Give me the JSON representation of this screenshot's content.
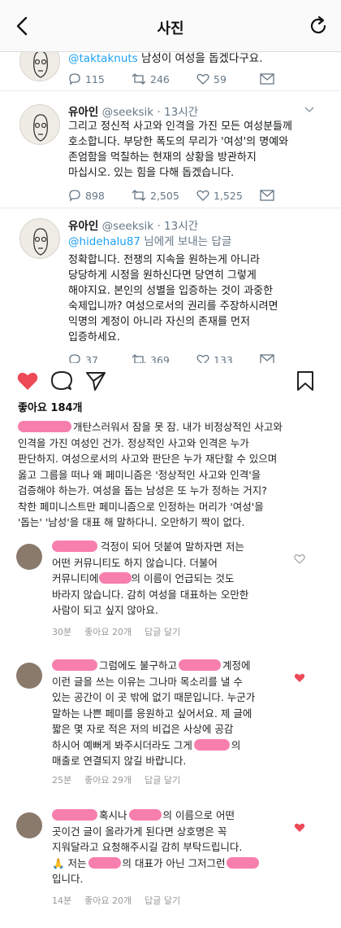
{
  "header": {
    "title": "사진"
  },
  "tweets": {
    "partial": {
      "mention": "@taktaknuts",
      "text": " 남성이 여성을 돕겠다구요.",
      "stats": {
        "replies": "115",
        "retweets": "246",
        "likes": "59"
      }
    },
    "tweet1": {
      "name": "유아인",
      "handle": "@seeksik",
      "time": "· 13시간",
      "lines": [
        "그리고 정신적 사고와 인격을 가진 모든 여성분들께",
        "호소합니다. 부당한 폭도의 무리가 '여성'의 명예와",
        "존엄함을 먹칠하는 현재의 상황을 방관하지",
        "마십시오. 있는 힘을 다해 돕겠습니다."
      ],
      "stats": {
        "replies": "898",
        "retweets": "2,505",
        "likes": "1,525"
      }
    },
    "tweet2": {
      "name": "유아인",
      "handle": "@seeksik",
      "time": "· 13시간",
      "reply_mention": "@hidehalu87",
      "reply_suffix": " 님에게 보내는 답글",
      "lines": [
        "정확합니다. 전쟁의 지속을 원하는게 아니라",
        "당당하게 시정을 원하신다면 당연히 그렇게",
        "해야지요. 본인의 성별을 입증하는 것이 과중한",
        "숙제입니까? 여성으로서의 권리를 주장하시려면",
        "익명의 계정이 아니라 자신의 존재를 먼저",
        "입증하세요."
      ],
      "stats": {
        "replies": "37",
        "retweets": "369",
        "likes": "133"
      }
    }
  },
  "post": {
    "likes_label": "좋아요 184개",
    "caption_lines": [
      "개탄스러워서 잠을 못 잠. 내가 비정상적인 사고와",
      "인격을 가진 여성인 건가. 정상적인 사고와 인격은 누가",
      "판단하지. 여성으로서의 사고와 판단은 누가 재단할 수 있으며",
      "옳고 그름을 떠나 왜 페미니즘은 '정상적인 사고와 인격'을",
      "검증해야 하는가. 여성을 돕는 남성은 또 누가 정하는 거지?",
      "착한 페미니스트만 페미니즘으로 인정하는 머리가 '여성'을",
      "'돕는' '남성'을 대표 해 말하다니. 오만하기 짝이 없다."
    ]
  },
  "comments": [
    {
      "line1": "걱정이 되어 덧붙여 말하자면 저는",
      "line2": "어떤 커뮤니티도 하지 않습니다. 더불어",
      "line3a": "커뮤니티에",
      "line3b": "의 이름이 언급되는 것도",
      "line4": "바라지 않습니다. 감히 여성을 대표하는 오만한",
      "line5": "사람이 되고 싶지 않아요.",
      "time": "30분",
      "likes": "좋아요 20개",
      "reply": "답글 달기",
      "liked": false
    },
    {
      "line1a": "그럼에도 불구하고",
      "line1b": "계정에",
      "line2": "이런 글을 쓰는 이유는 그나마 목소리를 낼 수",
      "line3": "있는 공간이 이 곳 밖에 없기 때문입니다. 누군가",
      "line4": "말하는 나쁜 페미를 응원하고 싶어서요. 제 글에",
      "line5": "짧은 몇 자로 적은 저의 비겁은 사상에 공감",
      "line6a": "하시어 예뻐게 봐주시더라도 그게",
      "line6b": "의",
      "line7": "매출로 연결되지 않길 바랍니다.",
      "time": "25분",
      "likes": "좋아요 29개",
      "reply": "답글 달기",
      "liked": true
    },
    {
      "line1a": "혹시나",
      "line1b": "의 이름으로 어떤",
      "line2": "곳이건 글이 올라가게 된다면 상호명은 꼭",
      "line3": "지워달라고 요청해주시길 감히 부탁드립니다.",
      "line4a": "🙏 저는",
      "line4b": "의 대표가 아닌 그저그런",
      "line5": "입니다.",
      "time": "14분",
      "likes": "좋아요 20개",
      "reply": "답글 달기",
      "liked": true
    }
  ],
  "colors": {
    "heart_red": "#ed4956",
    "mask_pink": "#f77fae",
    "twitter_blue": "#1da1f2"
  }
}
